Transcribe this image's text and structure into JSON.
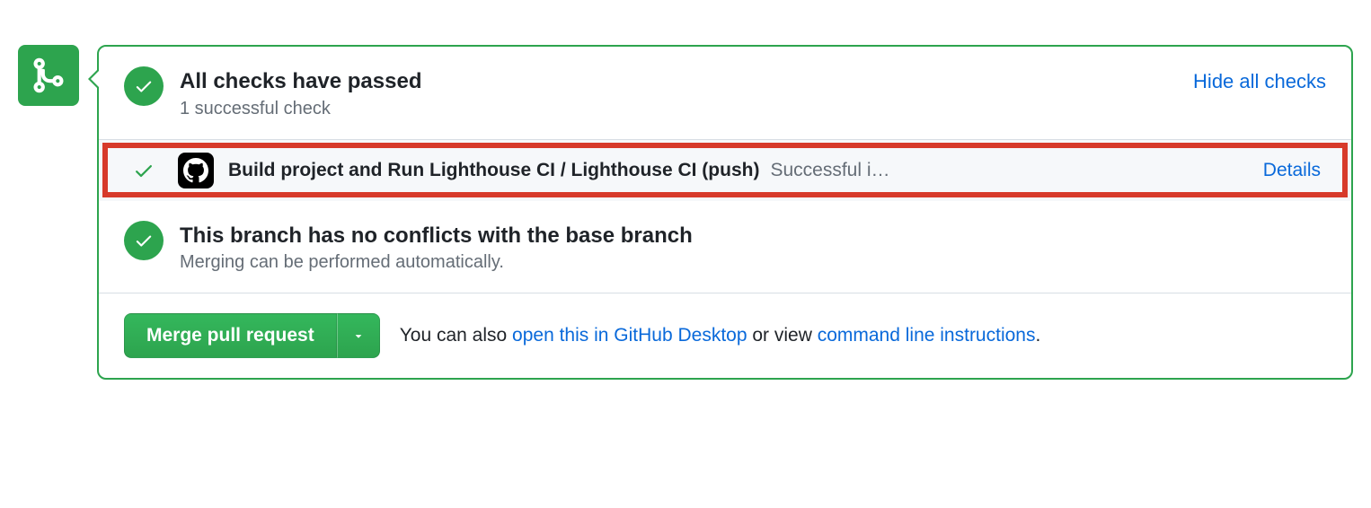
{
  "checks": {
    "title": "All checks have passed",
    "subtitle": "1 successful check",
    "toggle_label": "Hide all checks",
    "items": [
      {
        "name": "Build project and Run Lighthouse CI / Lighthouse CI (push)",
        "status": "Successful i…",
        "details_label": "Details"
      }
    ]
  },
  "conflicts": {
    "title": "This branch has no conflicts with the base branch",
    "subtitle": "Merging can be performed automatically."
  },
  "actions": {
    "merge_label": "Merge pull request",
    "text_prefix": "You can also ",
    "link1": "open this in GitHub Desktop",
    "text_mid": " or view ",
    "link2": "command line instructions",
    "text_suffix": "."
  }
}
